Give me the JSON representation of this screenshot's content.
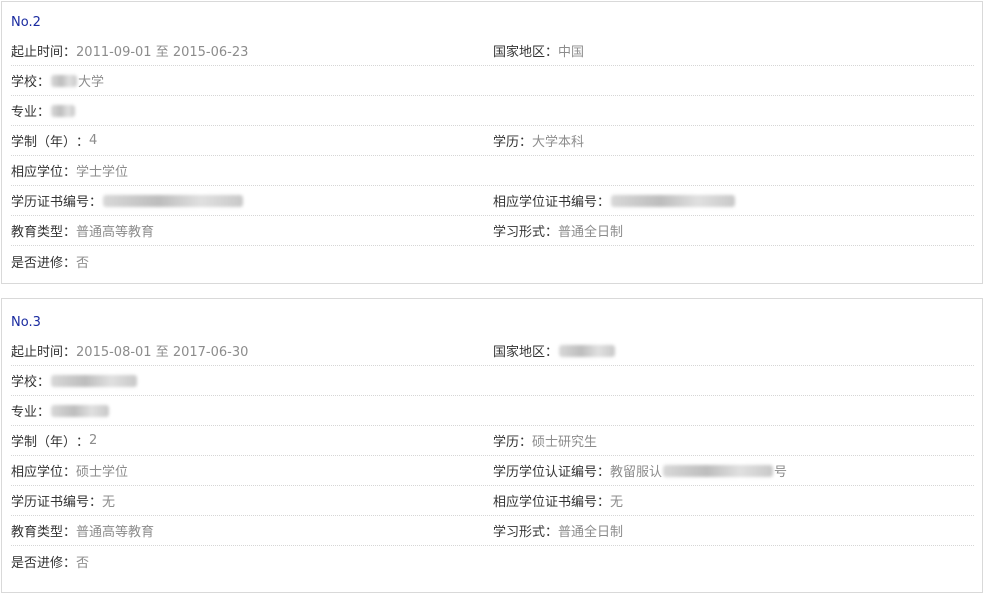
{
  "records": [
    {
      "no": "No.2",
      "rows": [
        [
          {
            "label": "起止时间",
            "value": "2011-09-01 至 2015-06-23"
          },
          {
            "label": "国家地区",
            "value": "中国"
          }
        ],
        [
          {
            "label": "学校",
            "value": "大学",
            "blur_before": 26
          }
        ],
        [
          {
            "label": "专业",
            "value": "",
            "blur_before": 24
          }
        ],
        [
          {
            "label": "学制（年）",
            "value": "4"
          },
          {
            "label": "学历",
            "value": "大学本科"
          }
        ],
        [
          {
            "label": "相应学位",
            "value": "学士学位"
          }
        ],
        [
          {
            "label": "学历证书编号",
            "value": "",
            "blur_before": 140
          },
          {
            "label": "相应学位证书编号",
            "value": "",
            "blur_before": 124
          }
        ],
        [
          {
            "label": "教育类型",
            "value": "普通高等教育"
          },
          {
            "label": "学习形式",
            "value": "普通全日制"
          }
        ],
        [
          {
            "label": "是否进修",
            "value": "否"
          }
        ]
      ]
    },
    {
      "no": "No.3",
      "rows": [
        [
          {
            "label": "起止时间",
            "value": "2015-08-01 至 2017-06-30"
          },
          {
            "label": "国家地区",
            "value": "",
            "blur_before": 56
          }
        ],
        [
          {
            "label": "学校",
            "value": "",
            "blur_before": 86
          }
        ],
        [
          {
            "label": "专业",
            "value": "",
            "blur_before": 58
          }
        ],
        [
          {
            "label": "学制（年）",
            "value": "2"
          },
          {
            "label": "学历",
            "value": "硕士研究生"
          }
        ],
        [
          {
            "label": "相应学位",
            "value": "硕士学位"
          },
          {
            "label": "学历学位认证编号",
            "value": "号",
            "prefix": "教留服认",
            "blur_before": 110
          }
        ],
        [
          {
            "label": "学历证书编号",
            "value": "无"
          },
          {
            "label": "相应学位证书编号",
            "value": "无"
          }
        ],
        [
          {
            "label": "教育类型",
            "value": "普通高等教育"
          },
          {
            "label": "学习形式",
            "value": "普通全日制"
          }
        ],
        [
          {
            "label": "是否进修",
            "value": "否"
          }
        ]
      ]
    }
  ],
  "colon": "：",
  "colors": {
    "number": "#1a2ba0",
    "label": "#333333",
    "value": "#8c8c8c",
    "border": "#d9d9d9"
  }
}
